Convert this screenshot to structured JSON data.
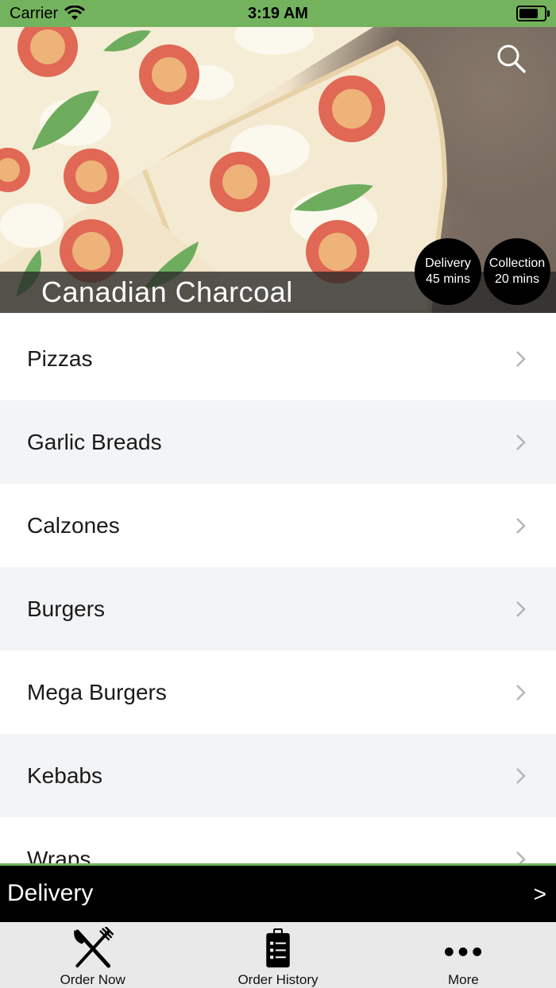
{
  "status_bar": {
    "carrier": "Carrier",
    "time": "3:19 AM",
    "battery_level": 0.9
  },
  "hero": {
    "restaurant_name": "Canadian Charcoal",
    "delivery": {
      "label": "Delivery",
      "time": "45 mins"
    },
    "collection": {
      "label": "Collection",
      "time": "20 mins"
    },
    "search_icon": "search-icon"
  },
  "categories": [
    {
      "label": "Pizzas"
    },
    {
      "label": "Garlic Breads"
    },
    {
      "label": "Calzones"
    },
    {
      "label": "Burgers"
    },
    {
      "label": "Mega Burgers"
    },
    {
      "label": "Kebabs"
    },
    {
      "label": "Wraps"
    }
  ],
  "delivery_bar": {
    "label": "Delivery",
    "arrow": ">"
  },
  "tabs": [
    {
      "label": "Order Now",
      "icon": "fork-knife-icon"
    },
    {
      "label": "Order History",
      "icon": "clipboard-list-icon"
    },
    {
      "label": "More",
      "icon": "more-dots-icon"
    }
  ],
  "colors": {
    "accent_green": "#74b35e",
    "delivery_bar": "#000000",
    "row_alt": "#f3f4f6"
  }
}
